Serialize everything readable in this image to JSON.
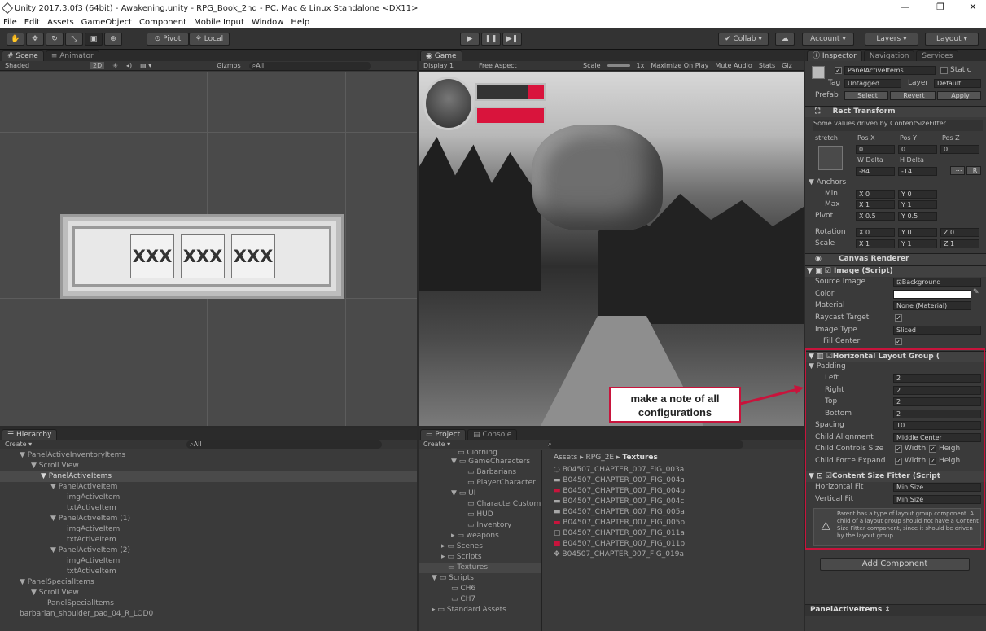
{
  "window": {
    "title": "Unity 2017.3.0f3 (64bit) - Awakening.unity - RPG_Book_2nd - PC, Mac & Linux Standalone <DX11>"
  },
  "menu": [
    "File",
    "Edit",
    "Assets",
    "GameObject",
    "Component",
    "Mobile Input",
    "Window",
    "Help"
  ],
  "toolbar": {
    "pivot": "Pivot",
    "local": "Local",
    "collab": "Collab",
    "account": "Account",
    "layers": "Layers",
    "layout": "Layout"
  },
  "scene": {
    "tab": "Scene",
    "tab2": "Animator",
    "shaded": "Shaded",
    "mode2d": "2D",
    "gizmos": "Gizmos",
    "search": "All",
    "slot_text": "XXX"
  },
  "game": {
    "tab": "Game",
    "display": "Display 1",
    "aspect": "Free Aspect",
    "scale": "Scale",
    "scale_val": "1x",
    "maximize": "Maximize On Play",
    "mute": "Mute Audio",
    "stats": "Stats",
    "gizmos": "Giz"
  },
  "annotation": {
    "text": "make a note of all configurations"
  },
  "hierarchy": {
    "tab": "Hierarchy",
    "create": "Create",
    "search": "All",
    "items": [
      "PanelActiveInventoryItems",
      "Scroll View",
      "PanelActiveItems",
      "PanelActiveItem",
      "imgActiveItem",
      "txtActiveItem",
      "PanelActiveItem (1)",
      "imgActiveItem",
      "txtActiveItem",
      "PanelActiveItem (2)",
      "imgActiveItem",
      "txtActiveItem",
      "PanelSpecialItems",
      "Scroll View",
      "PanelSpecialItems",
      "barbarian_shoulder_pad_04_R_LOD0"
    ]
  },
  "project": {
    "tab": "Project",
    "tab2": "Console",
    "create": "Create",
    "folders": [
      "Clothing",
      "GameCharacters",
      "Barbarians",
      "PlayerCharacter",
      "UI",
      "CharacterCustom",
      "HUD",
      "Inventory",
      "weapons",
      "Scenes",
      "Scripts",
      "Textures",
      "Scripts",
      "CH6",
      "CH7",
      "Standard Assets"
    ],
    "breadcrumb": [
      "Assets",
      "RPG_2E",
      "Textures"
    ],
    "files": [
      "B04507_CHAPTER_007_FIG_003a",
      "B04507_CHAPTER_007_FIG_004a",
      "B04507_CHAPTER_007_FIG_004b",
      "B04507_CHAPTER_007_FIG_004c",
      "B04507_CHAPTER_007_FIG_005a",
      "B04507_CHAPTER_007_FIG_005b",
      "B04507_CHAPTER_007_FIG_011a",
      "B04507_CHAPTER_007_FIG_011b",
      "B04507_CHAPTER_007_FIG_019a"
    ]
  },
  "inspector": {
    "tab": "Inspector",
    "tab2": "Navigation",
    "tab3": "Services",
    "object_name": "PanelActiveItems",
    "static": "Static",
    "tag_label": "Tag",
    "tag": "Untagged",
    "layer_label": "Layer",
    "layer": "Default",
    "prefab": "Prefab",
    "select": "Select",
    "revert": "Revert",
    "apply": "Apply",
    "rect_transform": "Rect Transform",
    "driven_note": "Some values driven by ContentSizeFitter.",
    "stretch": "stretch",
    "posx": "Pos X",
    "posy": "Pos Y",
    "posz": "Pos Z",
    "posx_v": "0",
    "posy_v": "0",
    "posz_v": "0",
    "wdelta": "W Delta",
    "hdelta": "H Delta",
    "wdelta_v": "-84",
    "hdelta_v": "-14",
    "anchors": "Anchors",
    "min": "Min",
    "max": "Max",
    "pivot": "Pivot",
    "anchor_min_x": "0",
    "anchor_min_y": "0",
    "anchor_max_x": "1",
    "anchor_max_y": "1",
    "pivot_x": "0.5",
    "pivot_y": "0.5",
    "rotation": "Rotation",
    "scale": "Scale",
    "rot_x": "0",
    "rot_y": "0",
    "rot_z": "0",
    "scale_x": "1",
    "scale_y": "1",
    "scale_z": "1",
    "canvas_renderer": "Canvas Renderer",
    "image": "Image (Script)",
    "source_image": "Source Image",
    "source_image_v": "Background",
    "color": "Color",
    "material": "Material",
    "material_v": "None (Material)",
    "raycast": "Raycast Target",
    "image_type": "Image Type",
    "image_type_v": "Sliced",
    "fill_center": "Fill Center",
    "hlg": "Horizontal Layout Group (",
    "padding": "Padding",
    "left": "Left",
    "right": "Right",
    "top": "Top",
    "bottom": "Bottom",
    "pad_left": "2",
    "pad_right": "2",
    "pad_top": "2",
    "pad_bottom": "2",
    "spacing": "Spacing",
    "spacing_v": "10",
    "child_alignment": "Child Alignment",
    "child_alignment_v": "Middle Center",
    "child_controls": "Child Controls Size",
    "child_force": "Child Force Expand",
    "width": "Width",
    "height": "Heigh",
    "csf": "Content Size Fitter (Script",
    "h_fit": "Horizontal Fit",
    "h_fit_v": "Min Size",
    "v_fit": "Vertical Fit",
    "v_fit_v": "Min Size",
    "warning": "Parent has a type of layout group component. A child of a layout group should not have a Content Size Fitter component, since it should be driven by the layout group.",
    "add_component": "Add Component",
    "footer": "PanelActiveItems"
  },
  "colors": {
    "highlight": "#c8143c",
    "health": "#d9143c"
  }
}
